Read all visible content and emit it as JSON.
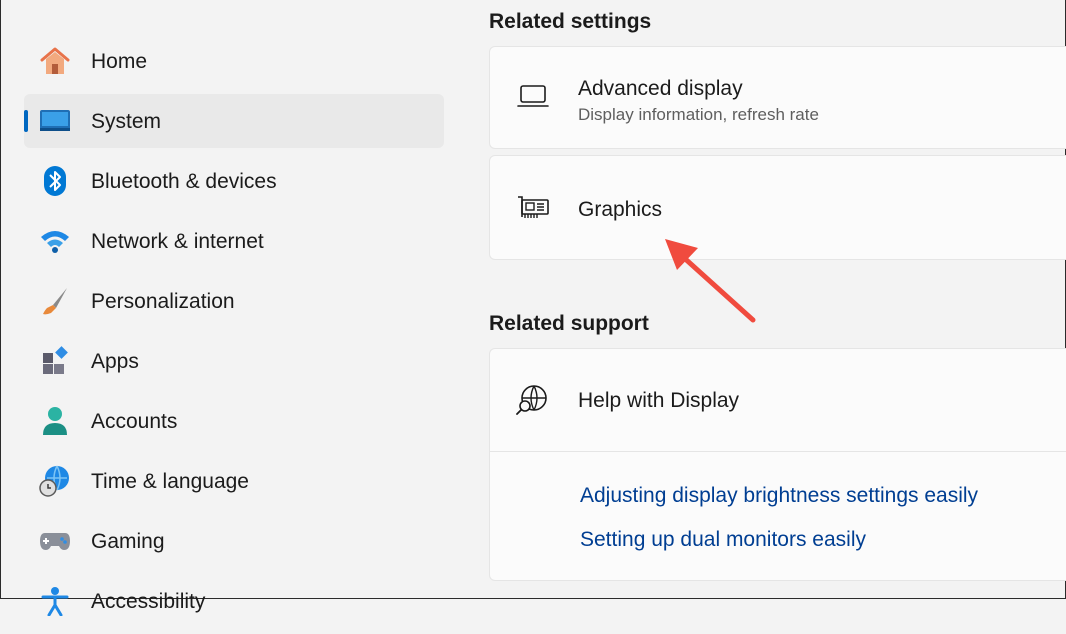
{
  "sidebar": {
    "items": [
      {
        "label": "Home",
        "icon": "home-icon"
      },
      {
        "label": "System",
        "icon": "system-icon",
        "selected": true
      },
      {
        "label": "Bluetooth & devices",
        "icon": "bluetooth-icon"
      },
      {
        "label": "Network & internet",
        "icon": "wifi-icon"
      },
      {
        "label": "Personalization",
        "icon": "paintbrush-icon"
      },
      {
        "label": "Apps",
        "icon": "apps-icon"
      },
      {
        "label": "Accounts",
        "icon": "person-icon"
      },
      {
        "label": "Time & language",
        "icon": "globe-clock-icon"
      },
      {
        "label": "Gaming",
        "icon": "gamepad-icon"
      },
      {
        "label": "Accessibility",
        "icon": "accessibility-icon"
      }
    ]
  },
  "main": {
    "related_settings": {
      "title": "Related settings",
      "advanced_display": {
        "title": "Advanced display",
        "subtitle": "Display information, refresh rate",
        "icon": "laptop-icon"
      },
      "graphics": {
        "title": "Graphics",
        "icon": "graphics-card-icon"
      }
    },
    "related_support": {
      "title": "Related support",
      "help": {
        "title": "Help with Display",
        "icon": "globe-search-icon"
      },
      "links": [
        "Adjusting display brightness settings easily",
        "Setting up dual monitors easily"
      ]
    }
  },
  "colors": {
    "accent": "#0067c0",
    "link": "#003e92",
    "annotation_arrow": "#f04b3e"
  }
}
